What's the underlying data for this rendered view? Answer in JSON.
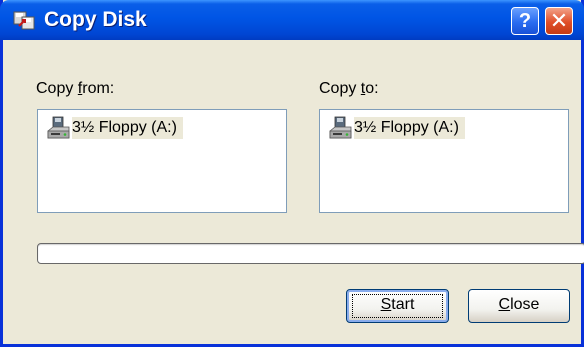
{
  "window": {
    "title": "Copy Disk",
    "title_icon": "copy-disk-icon",
    "help_glyph": "?",
    "close_glyph": "✕"
  },
  "copy_from": {
    "label_prefix": "Copy ",
    "label_underlined": "f",
    "label_suffix": "rom:",
    "drive_label": "3½ Floppy (A:)",
    "drive_icon": "floppy-drive-icon"
  },
  "copy_to": {
    "label_prefix": "Copy ",
    "label_underlined": "t",
    "label_suffix": "o:",
    "drive_label": "3½ Floppy (A:)",
    "drive_icon": "floppy-drive-icon"
  },
  "progress": {
    "value": 0
  },
  "buttons": {
    "start_underlined": "S",
    "start_rest": "tart",
    "close_underlined": "C",
    "close_rest": "lose"
  },
  "colors": {
    "title_bar": "#0055e5",
    "window_face": "#ece9d8",
    "close_button": "#e04e28",
    "listbox_border": "#7f9db9"
  }
}
